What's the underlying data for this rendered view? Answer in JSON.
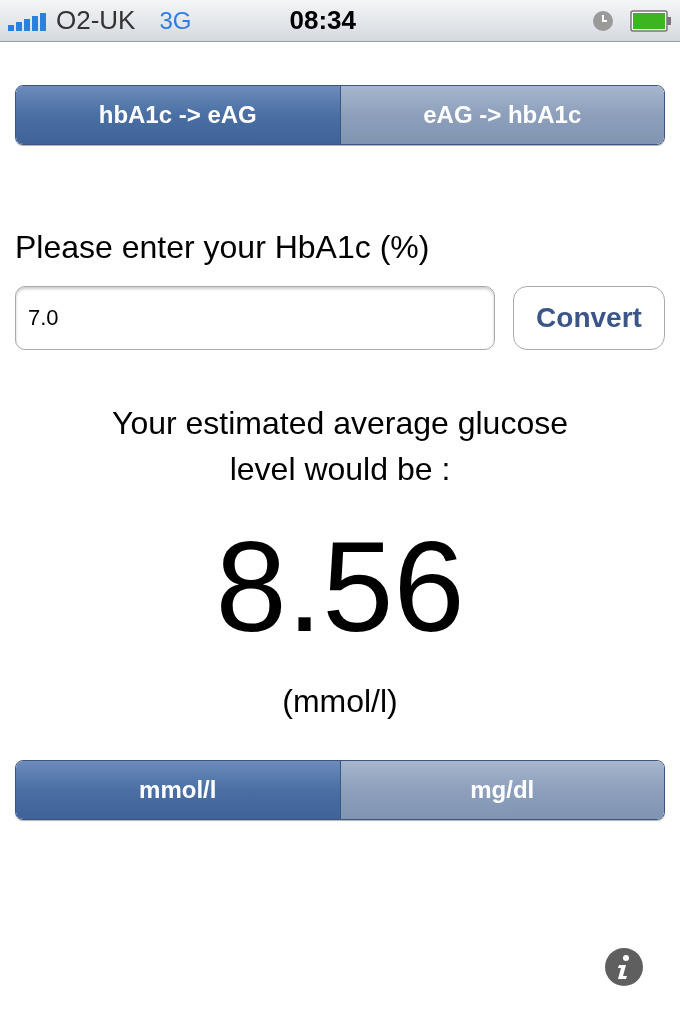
{
  "status_bar": {
    "carrier": "O2-UK",
    "network": "3G",
    "time": "08:34"
  },
  "mode_tabs": [
    {
      "label": "hbA1c -> eAG",
      "selected": true
    },
    {
      "label": "eAG -> hbA1c",
      "selected": false
    }
  ],
  "input_label": "Please enter your HbA1c (%)",
  "input_value": "7.0",
  "convert_button": "Convert",
  "result_caption": "Your estimated average glucose level would be :",
  "result_value": "8.56",
  "result_unit": "(mmol/l)",
  "unit_tabs": [
    {
      "label": "mmol/l",
      "selected": true
    },
    {
      "label": "mg/dl",
      "selected": false
    }
  ]
}
